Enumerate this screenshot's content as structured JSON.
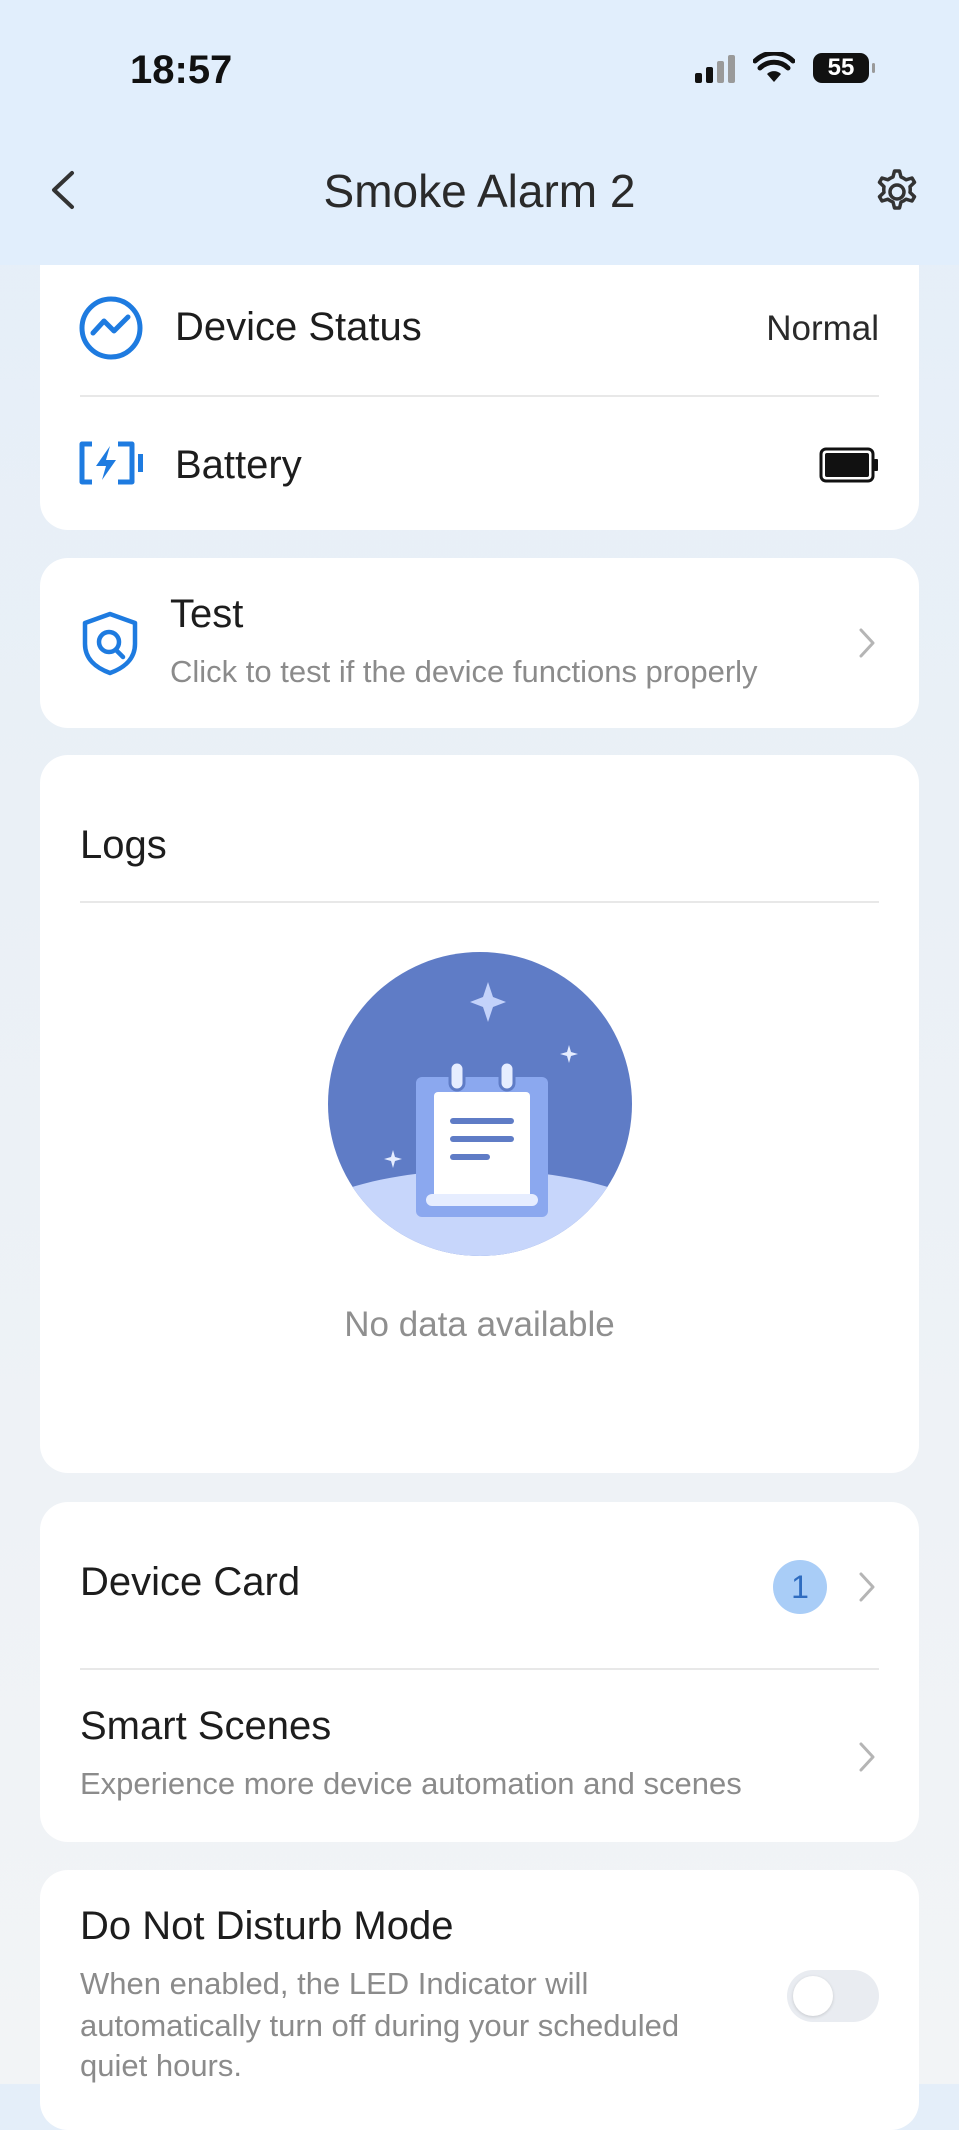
{
  "status_bar": {
    "time": "18:57",
    "battery": "55"
  },
  "header": {
    "title": "Smoke Alarm 2"
  },
  "status_card": {
    "device_status_label": "Device Status",
    "device_status_value": "Normal",
    "battery_label": "Battery"
  },
  "test_card": {
    "title": "Test",
    "subtitle": "Click to test if the device functions properly"
  },
  "logs_card": {
    "title": "Logs",
    "empty_text": "No data available"
  },
  "links_card": {
    "device_card_label": "Device Card",
    "device_card_badge": "1",
    "smart_scenes_label": "Smart Scenes",
    "smart_scenes_sub": "Experience more device automation and scenes"
  },
  "dnd_card": {
    "title": "Do Not Disturb Mode",
    "desc_line1": "When enabled, the LED Indicator will",
    "desc_line2": "automatically turn off during your scheduled",
    "desc_line3": "quiet hours.",
    "enabled": false
  },
  "colors": {
    "accent": "#1e7be0",
    "illustration": "#5f7cc6",
    "badge": "#a9cdf7"
  }
}
